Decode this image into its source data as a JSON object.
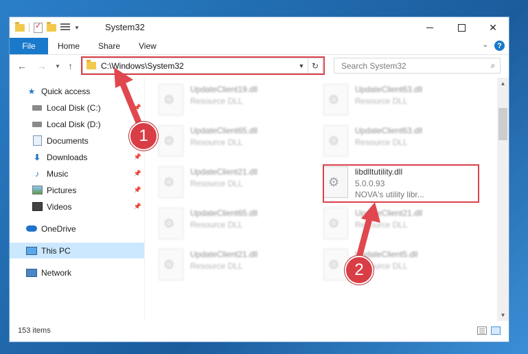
{
  "window": {
    "title": "System32"
  },
  "ribbon": {
    "file": "File",
    "home": "Home",
    "share": "Share",
    "view": "View",
    "help": "?"
  },
  "nav": {
    "address": "C:\\Windows\\System32",
    "search_placeholder": "Search System32"
  },
  "sidebar": {
    "items": [
      {
        "label": "Quick access"
      },
      {
        "label": "Local Disk (C:)"
      },
      {
        "label": "Local Disk (D:)"
      },
      {
        "label": "Documents"
      },
      {
        "label": "Downloads"
      },
      {
        "label": "Music"
      },
      {
        "label": "Pictures"
      },
      {
        "label": "Videos"
      },
      {
        "label": "OneDrive"
      },
      {
        "label": "This PC"
      },
      {
        "label": "Network"
      }
    ]
  },
  "files": {
    "left": [
      {
        "name": "UpdateClient19.dll",
        "type": "Resource DLL"
      },
      {
        "name": "UpdateClient65.dll",
        "type": "Resource DLL"
      },
      {
        "name": "UpdateClient21.dll",
        "type": "Resource DLL"
      },
      {
        "name": "UpdateClient65.dll",
        "type": "Resource DLL"
      },
      {
        "name": "UpdateClient21.dll",
        "type": "Resource DLL"
      }
    ],
    "right": [
      {
        "name": "UpdateClient63.dll",
        "type": "Resource DLL"
      },
      {
        "name": "UpdateClient63.dll",
        "type": "Resource DLL"
      },
      {
        "name": "UpdateClient21.dll",
        "type": "Resource DLL"
      },
      {
        "name": "UpdateClient5.dll",
        "type": "Resource DLL"
      }
    ],
    "target": {
      "name": "libdlltutility.dll",
      "version": "5.0.0.93",
      "description": "NOVA's utility libr..."
    }
  },
  "status": {
    "count": "153 items"
  },
  "annotations": {
    "step1": "1",
    "step2": "2",
    "color": "#d9414a"
  }
}
